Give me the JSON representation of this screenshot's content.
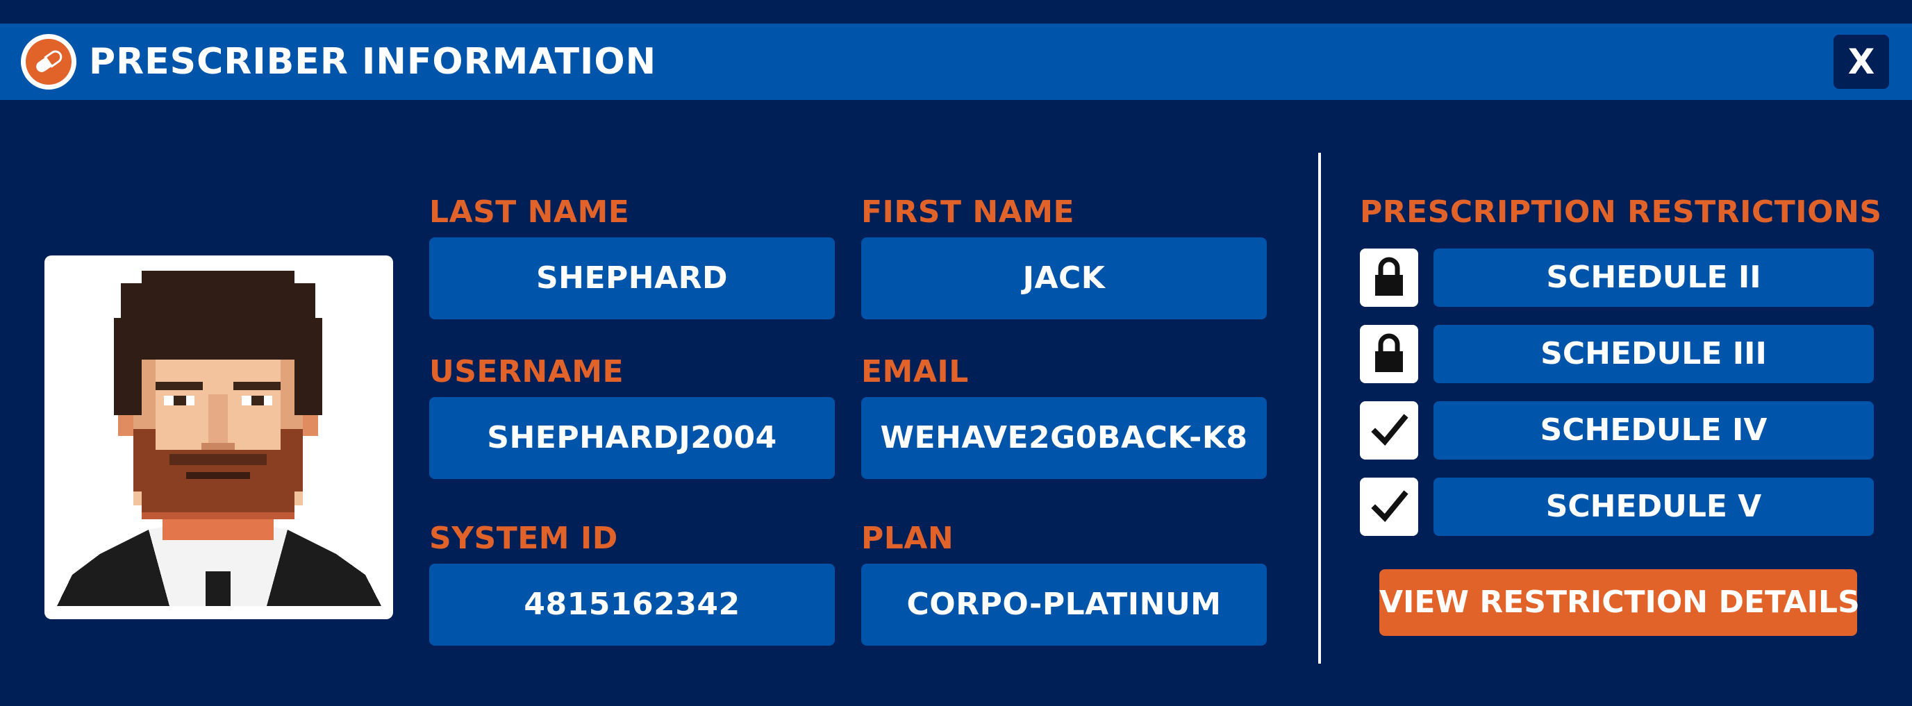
{
  "window": {
    "title": "PRESCRIBER INFORMATION",
    "close_label": "X",
    "logo_icon": "pill-icon"
  },
  "portrait": {
    "icon": "pixel-portrait-avatar"
  },
  "fields": {
    "last_name": {
      "label": "LAST NAME",
      "value": "SHEPHARD"
    },
    "first_name": {
      "label": "FIRST NAME",
      "value": "JACK"
    },
    "username": {
      "label": "USERNAME",
      "value": "SHEPHARDJ2004"
    },
    "email": {
      "label": "EMAIL",
      "value": "WEHAVE2G0BACK-K8"
    },
    "system_id": {
      "label": "SYSTEM ID",
      "value": "4815162342"
    },
    "plan": {
      "label": "PLAN",
      "value": "CORPO-PLATINUM"
    }
  },
  "restrictions": {
    "title": "PRESCRIPTION RESTRICTIONS",
    "items": [
      {
        "label": "SCHEDULE II",
        "status": "locked",
        "icon": "lock-icon"
      },
      {
        "label": "SCHEDULE III",
        "status": "locked",
        "icon": "lock-icon"
      },
      {
        "label": "SCHEDULE IV",
        "status": "allowed",
        "icon": "checkmark-icon"
      },
      {
        "label": "SCHEDULE V",
        "status": "allowed",
        "icon": "checkmark-icon"
      }
    ],
    "details_button": "VIEW RESTRICTION DETAILS"
  },
  "colors": {
    "background": "#011f57",
    "panel_blue": "#0054aa",
    "accent_orange": "#e2632a",
    "text_white": "#ffffff"
  }
}
